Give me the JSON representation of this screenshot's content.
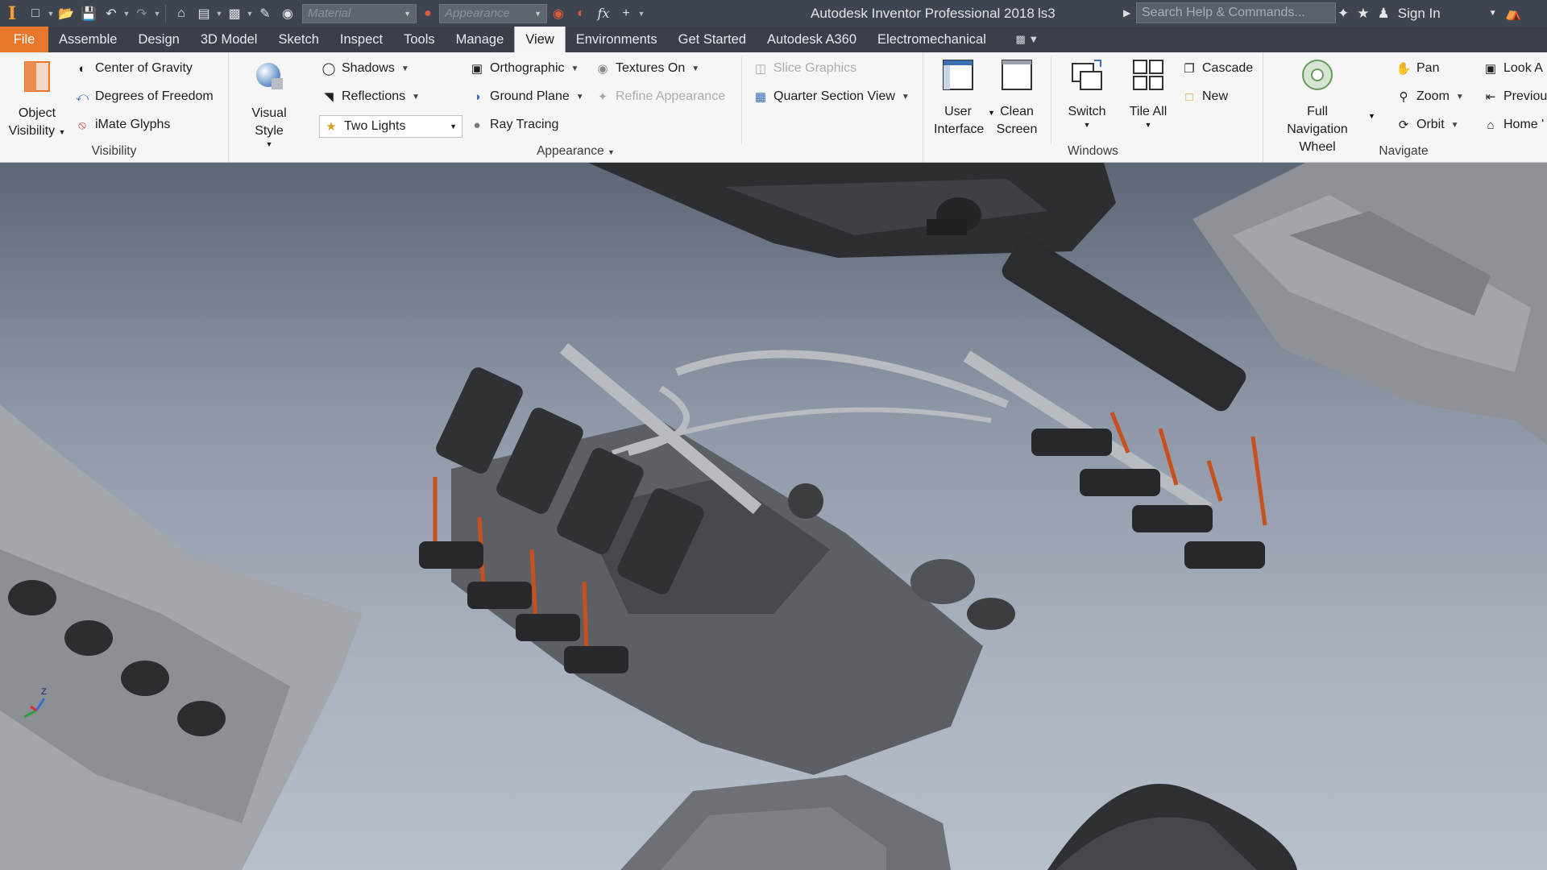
{
  "titlebar": {
    "app_title": "Autodesk Inventor Professional 2018",
    "document": "ls3",
    "material_placeholder": "Material",
    "appearance_placeholder": "Appearance",
    "search_placeholder": "Search Help & Commands...",
    "sign_in": "Sign In"
  },
  "menu": {
    "tabs": [
      "File",
      "Assemble",
      "Design",
      "3D Model",
      "Sketch",
      "Inspect",
      "Tools",
      "Manage",
      "View",
      "Environments",
      "Get Started",
      "Autodesk A360",
      "Electromechanical"
    ],
    "active": "View"
  },
  "ribbon": {
    "visibility": {
      "title": "Visibility",
      "object_visibility": "Object Visibility",
      "items": [
        "Center of Gravity",
        "Degrees of Freedom",
        "iMate Glyphs"
      ]
    },
    "appearance": {
      "title": "Appearance",
      "visual_style": "Visual Style",
      "shadows": "Shadows",
      "reflections": "Reflections",
      "lighting": "Two Lights",
      "orthographic": "Orthographic",
      "ground_plane": "Ground Plane",
      "ray_tracing": "Ray Tracing",
      "textures_on": "Textures On",
      "refine_appearance": "Refine Appearance",
      "slice_graphics": "Slice Graphics",
      "quarter_section_view": "Quarter Section View"
    },
    "windows": {
      "title": "Windows",
      "user_interface": "User Interface",
      "clean_screen": "Clean Screen",
      "switch": "Switch",
      "tile_all": "Tile All",
      "cascade": "Cascade",
      "new": "New"
    },
    "navigate": {
      "title": "Navigate",
      "full_navigation_wheel": "Full Navigation Wheel",
      "pan": "Pan",
      "zoom": "Zoom",
      "orbit": "Orbit",
      "look_at": "Look A",
      "previous": "Previou",
      "home": "Home '"
    }
  },
  "colors": {
    "titlebar": "#3f4550",
    "file_tab": "#e7772a",
    "ribbon": "#f6f6f6",
    "ignition_wire": "#c8501e"
  }
}
